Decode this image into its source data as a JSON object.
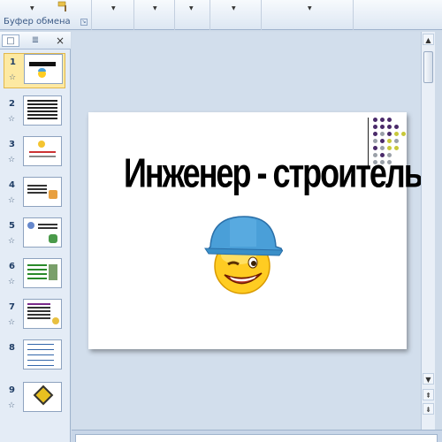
{
  "ribbon": {
    "clipboard_label": "Буфер обмена",
    "dropdown_arrow": "▼",
    "launcher": "↘"
  },
  "left_pane": {
    "tab_slides_icon": "□",
    "tab_outline_icon": "≣",
    "close": "×"
  },
  "slides": [
    {
      "number": "1",
      "selected": true,
      "thumb_title": "Инженер - строитель"
    },
    {
      "number": "2",
      "selected": false
    },
    {
      "number": "3",
      "selected": false
    },
    {
      "number": "4",
      "selected": false
    },
    {
      "number": "5",
      "selected": false
    },
    {
      "number": "6",
      "selected": false
    },
    {
      "number": "7",
      "selected": false
    },
    {
      "number": "8",
      "selected": false
    },
    {
      "number": "9",
      "selected": false
    }
  ],
  "star_icon": "☆",
  "scroll": {
    "up": "▲",
    "down": "▼",
    "prev": "⇞",
    "next": "⇟"
  },
  "slide": {
    "title": "Инженер - строитель"
  },
  "colors": {
    "helmet": "#4a9fd8",
    "face": "#ffcc22",
    "dot_purple": "#4a2a6a",
    "dot_gray": "#9aa0a8",
    "dot_yellow": "#c8c83a"
  }
}
